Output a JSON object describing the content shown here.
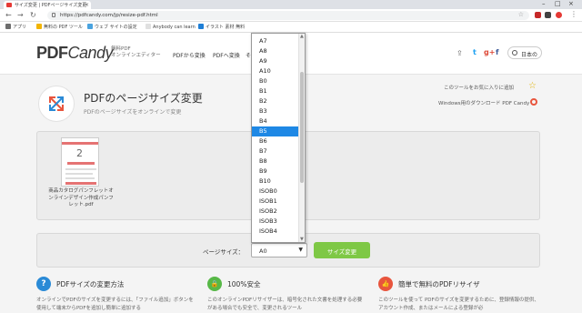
{
  "browser": {
    "tab_title": "サイズ変更 | PDFページサイズ変更",
    "url": "https://pdfcandy.com/jp/resize-pdf.html",
    "bookmarks": [
      "アプリ",
      "無料の PDF ツール",
      "ウェブ サイトの設定",
      "Anybody can learn",
      "イラスト 素材 無料"
    ],
    "bookmark_colors": [
      "#6d6d6d",
      "#f2b400",
      "#4aa3df",
      "#e0e0e0",
      "#1f7fd6"
    ]
  },
  "site": {
    "logo_main": "PDF",
    "logo_candy": "Candy",
    "logo_sub1": "無料PDF",
    "logo_sub2": "オンラインエディター",
    "nav": [
      "PDFから変換",
      "PDFへ変換",
      "そ"
    ],
    "lang": "日本の"
  },
  "tool": {
    "title": "PDFのページサイズ変更",
    "subtitle": "PDFのページサイズをオンラインで変更",
    "bookmark_text": "このツールをお気に入りに追加",
    "desktop_text": "Windows用のダウンロード PDF Candy"
  },
  "file": {
    "thumb_number": "2",
    "name": "商品カタログパンフレットオンラインデザイン作成パンフレット.pdf"
  },
  "options": {
    "page_size_label": "ページサイズ：",
    "selected_value": "A0",
    "submit_label": "サイズ変更"
  },
  "dropdown": {
    "items": [
      "A7",
      "A8",
      "A9",
      "A10",
      "B0",
      "B1",
      "B2",
      "B3",
      "B4",
      "B5",
      "B6",
      "B7",
      "B8",
      "B9",
      "B10",
      "ISOB0",
      "ISOB1",
      "ISOB2",
      "ISOB3",
      "ISOB4"
    ],
    "highlighted": "B5"
  },
  "features": [
    {
      "icon": "?",
      "title": "PDFサイズの変更方法",
      "text": "オンラインでPDFのサイズを変更するには、「ファイル追加」ボタンを使用して端末からPDFを追加し簡単に追加する",
      "color": "#2a8ad6"
    },
    {
      "icon": "🔒",
      "title": "100%安全",
      "text": "このオンラインPDFリサイザーは、暗号化された文書を処理する必要がある場合でも安全で、変更されるツール",
      "color": "#57b847"
    },
    {
      "icon": "👍",
      "title": "簡単で無料のPDFリサイザ",
      "text": "このツールを使って PDFのサイズを変更するために、登録情報の提供、アカウント作成、またはメールによる登録が必",
      "color": "#e8553d"
    }
  ]
}
